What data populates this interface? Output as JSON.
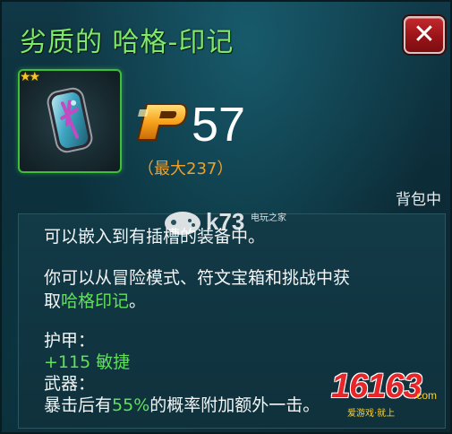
{
  "dialog": {
    "title": "劣质的 哈格-印记",
    "close_label": "✕"
  },
  "item": {
    "stars": "★★",
    "star_count": 2,
    "rune_icon": "haag-rune-icon"
  },
  "price": {
    "currency_icon": "p-coin-icon",
    "value": "57",
    "max_label": "（最大237）"
  },
  "location_label": "背包中",
  "description": {
    "line1": "可以嵌入到有插槽的装备中。",
    "line2": "你可以从冒险模式、符文宝箱和挑战中获",
    "line3_prefix": "取",
    "line3_highlight": "哈格印记",
    "line3_suffix": "。",
    "armor_label": "护甲：",
    "armor_value": "+115 敏捷",
    "weapon_label": "武器：",
    "weapon_prefix": "暴击后有",
    "weapon_highlight": "55%",
    "weapon_suffix": "的概率附加额外一击。"
  },
  "watermarks": {
    "k73_text": "k73",
    "k73_sub": "电玩之家",
    "site_main": "16163",
    "site_com": ".com",
    "site_sub": "爱游戏·就上"
  },
  "colors": {
    "title_green": "#7ee86a",
    "highlight_green": "#61e05a",
    "price_orange": "#f0a02a",
    "close_red": "#b01c20",
    "frame_green": "#3fbf3a"
  }
}
